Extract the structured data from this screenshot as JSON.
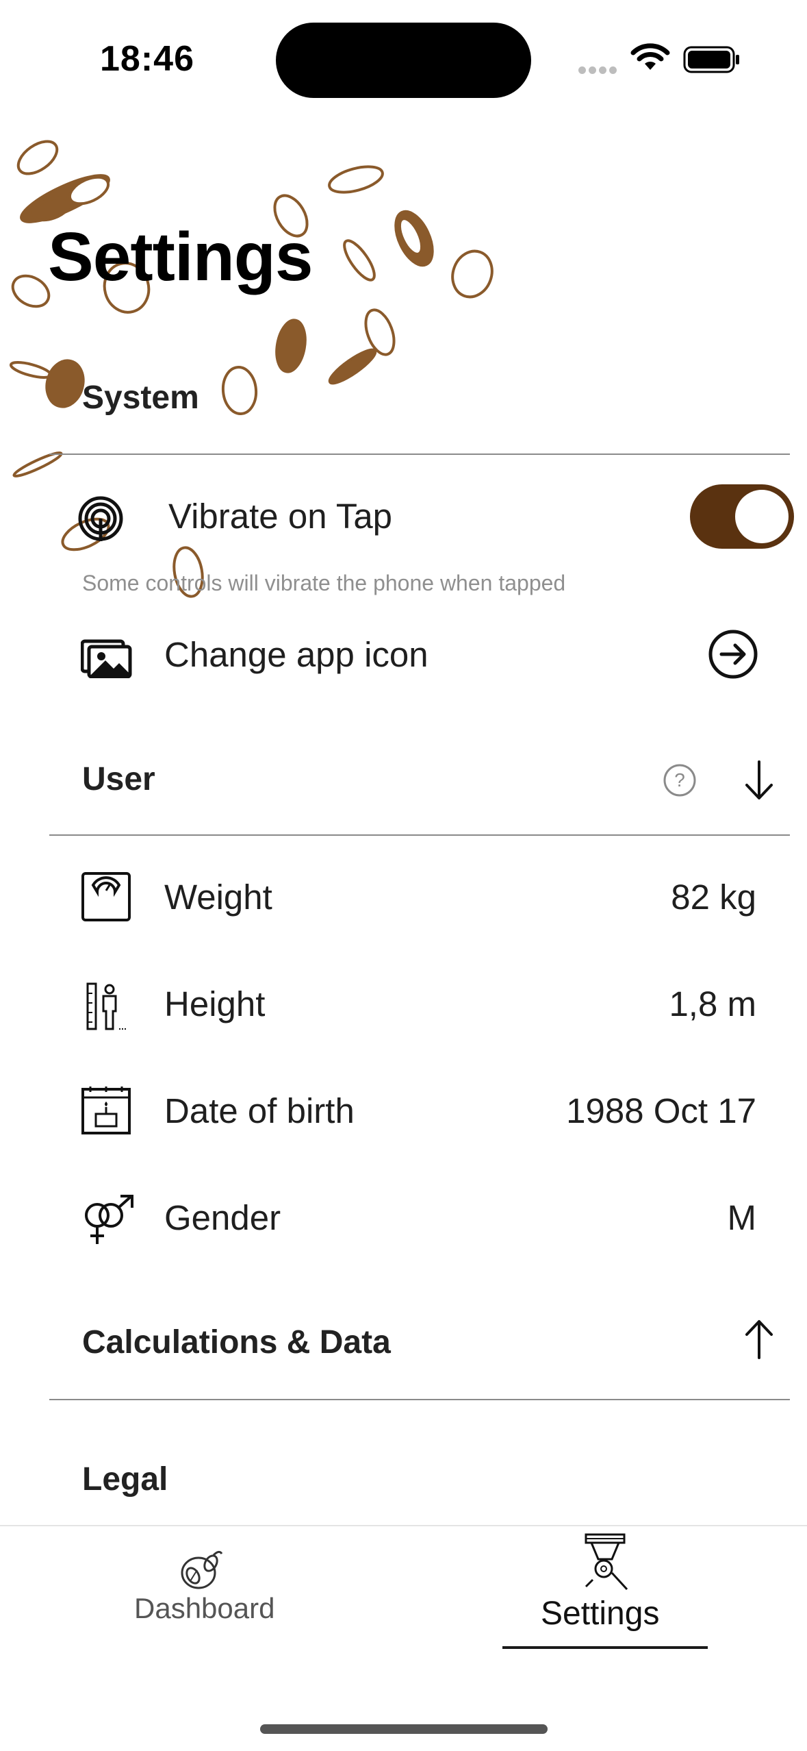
{
  "status_bar": {
    "time": "18:46"
  },
  "page": {
    "title": "Settings"
  },
  "system": {
    "header": "System",
    "vibrate": {
      "label": "Vibrate on Tap",
      "enabled": true,
      "hint": "Some controls will vibrate the phone when tapped"
    },
    "app_icon": {
      "label": "Change app icon"
    }
  },
  "user": {
    "header": "User",
    "rows": [
      {
        "label": "Weight",
        "value": "82 kg",
        "icon": "scale-icon"
      },
      {
        "label": "Height",
        "value": "1,8 m",
        "icon": "height-icon"
      },
      {
        "label": "Date of birth",
        "value": "1988 Oct 17",
        "icon": "birthday-calendar-icon"
      },
      {
        "label": "Gender",
        "value": "M",
        "icon": "gender-icon"
      }
    ]
  },
  "calculations": {
    "header": "Calculations & Data"
  },
  "legal": {
    "header": "Legal"
  },
  "tabbar": {
    "items": [
      {
        "label": "Dashboard",
        "active": false
      },
      {
        "label": "Settings",
        "active": true
      }
    ]
  },
  "colors": {
    "accent": "#5a3210",
    "cup_brown": "#8a5a2b"
  }
}
